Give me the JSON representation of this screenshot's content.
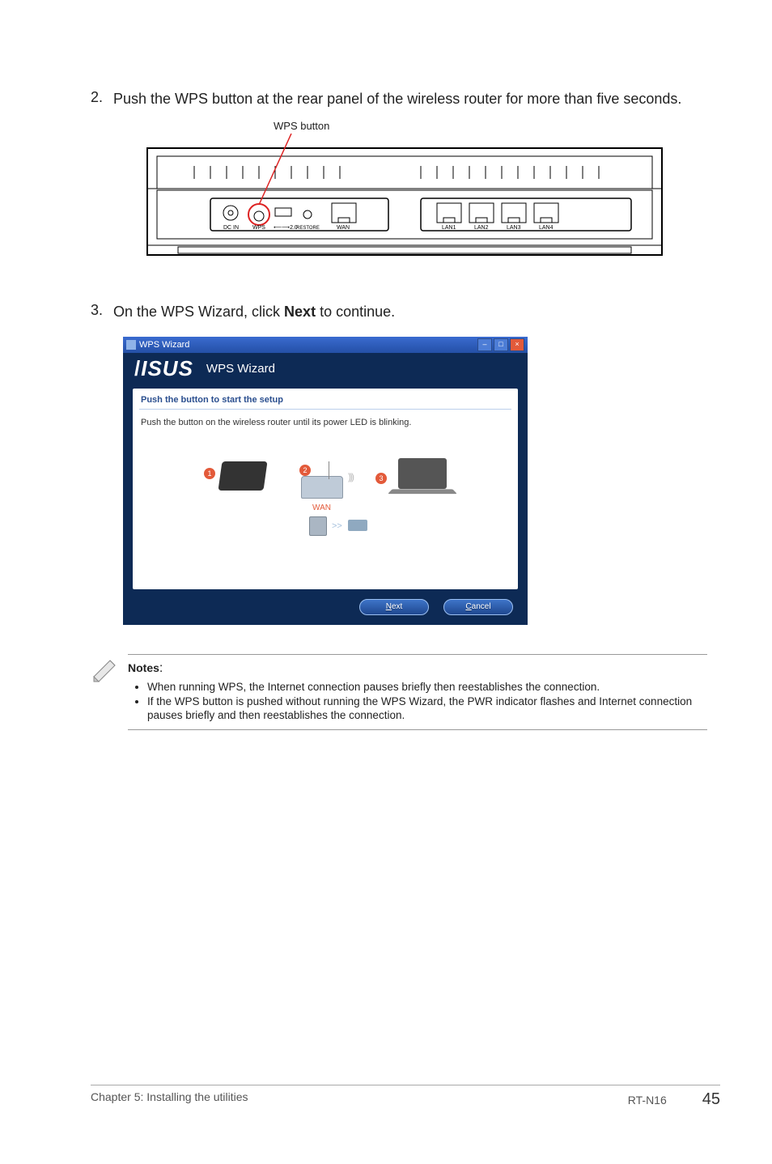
{
  "step2": {
    "num": "2.",
    "text_a": "Push the WPS button at the rear panel of the wireless router for more than five seconds."
  },
  "router_diagram": {
    "wps_button_label": "WPS button",
    "ports": {
      "dcin": "DC IN",
      "wps": "WPS",
      "usb": "USB",
      "restore": "RESTORE",
      "wan": "WAN",
      "lan1": "LAN1",
      "lan2": "LAN2",
      "lan3": "LAN3",
      "lan4": "LAN4"
    }
  },
  "step3": {
    "num": "3.",
    "text_a": "On the WPS Wizard, click ",
    "bold": "Next",
    "text_b": " to continue."
  },
  "wps_window": {
    "title": "WPS Wizard",
    "brand": "ISUS",
    "header": "WPS Wizard",
    "panel_head": "Push the button to start the setup",
    "panel_body": "Push the button on the wireless router until its power LED is blinking.",
    "wan_label": "WAN",
    "step_labels": {
      "one": "1",
      "two": "2",
      "three": "3"
    },
    "arrows": ">>",
    "buttons": {
      "next_u": "N",
      "next_rest": "ext",
      "cancel_u": "C",
      "cancel_rest": "ancel"
    }
  },
  "notes": {
    "heading": "Notes",
    "colon": ":",
    "items": [
      "When running WPS, the Internet connection pauses briefly then reestablishes the connection.",
      "If the WPS button is pushed without running the WPS Wizard, the PWR indicator flashes and Internet connection pauses briefly and then reestablishes the connection."
    ]
  },
  "footer": {
    "left": "Chapter 5: Installing the utilities",
    "model": "RT-N16",
    "page": "45"
  }
}
